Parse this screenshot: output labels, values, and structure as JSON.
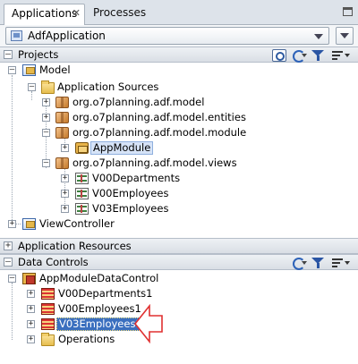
{
  "tabs": [
    {
      "label": "Applications",
      "active": true
    },
    {
      "label": "Processes",
      "active": false
    }
  ],
  "application_selector": {
    "value": "AdfApplication"
  },
  "projects_panel": {
    "title": "Projects",
    "toggle": "–",
    "tree": [
      {
        "label": "Model",
        "icon": "project-icon",
        "expander": "–"
      },
      {
        "label": "Application Sources",
        "icon": "folder-icon",
        "expander": "–"
      },
      {
        "label": "org.o7planning.adf.model",
        "icon": "package-icon",
        "expander": "+"
      },
      {
        "label": "org.o7planning.adf.model.entities",
        "icon": "package-icon",
        "expander": "+"
      },
      {
        "label": "org.o7planning.adf.model.module",
        "icon": "package-icon",
        "expander": "–"
      },
      {
        "label": "AppModule",
        "icon": "appmodule-icon",
        "expander": "+"
      },
      {
        "label": "org.o7planning.adf.model.views",
        "icon": "package-icon",
        "expander": "–"
      },
      {
        "label": "V00Departments",
        "icon": "view-object-icon",
        "expander": "+"
      },
      {
        "label": "V00Employees",
        "icon": "view-object-icon",
        "expander": "+"
      },
      {
        "label": "V03Employees",
        "icon": "view-object-icon",
        "expander": "+"
      },
      {
        "label": "ViewController",
        "icon": "project-icon",
        "expander": "+"
      }
    ]
  },
  "application_resources_panel": {
    "title": "Application Resources",
    "toggle": "+"
  },
  "data_controls_panel": {
    "title": "Data Controls",
    "toggle": "–",
    "tree": [
      {
        "label": "AppModuleDataControl",
        "icon": "data-control-icon",
        "expander": "–"
      },
      {
        "label": "V00Departments1",
        "icon": "collection-icon",
        "expander": "+"
      },
      {
        "label": "V00Employees1",
        "icon": "collection-icon",
        "expander": "+"
      },
      {
        "label": "V03Employees1",
        "icon": "collection-icon",
        "expander": "+"
      },
      {
        "label": "Operations",
        "icon": "folder-icon",
        "expander": "+"
      }
    ]
  },
  "colors": {
    "selection": "#d6e3f7",
    "highlight": "#3a6fbf",
    "annotation_arrow": "#e03030"
  }
}
